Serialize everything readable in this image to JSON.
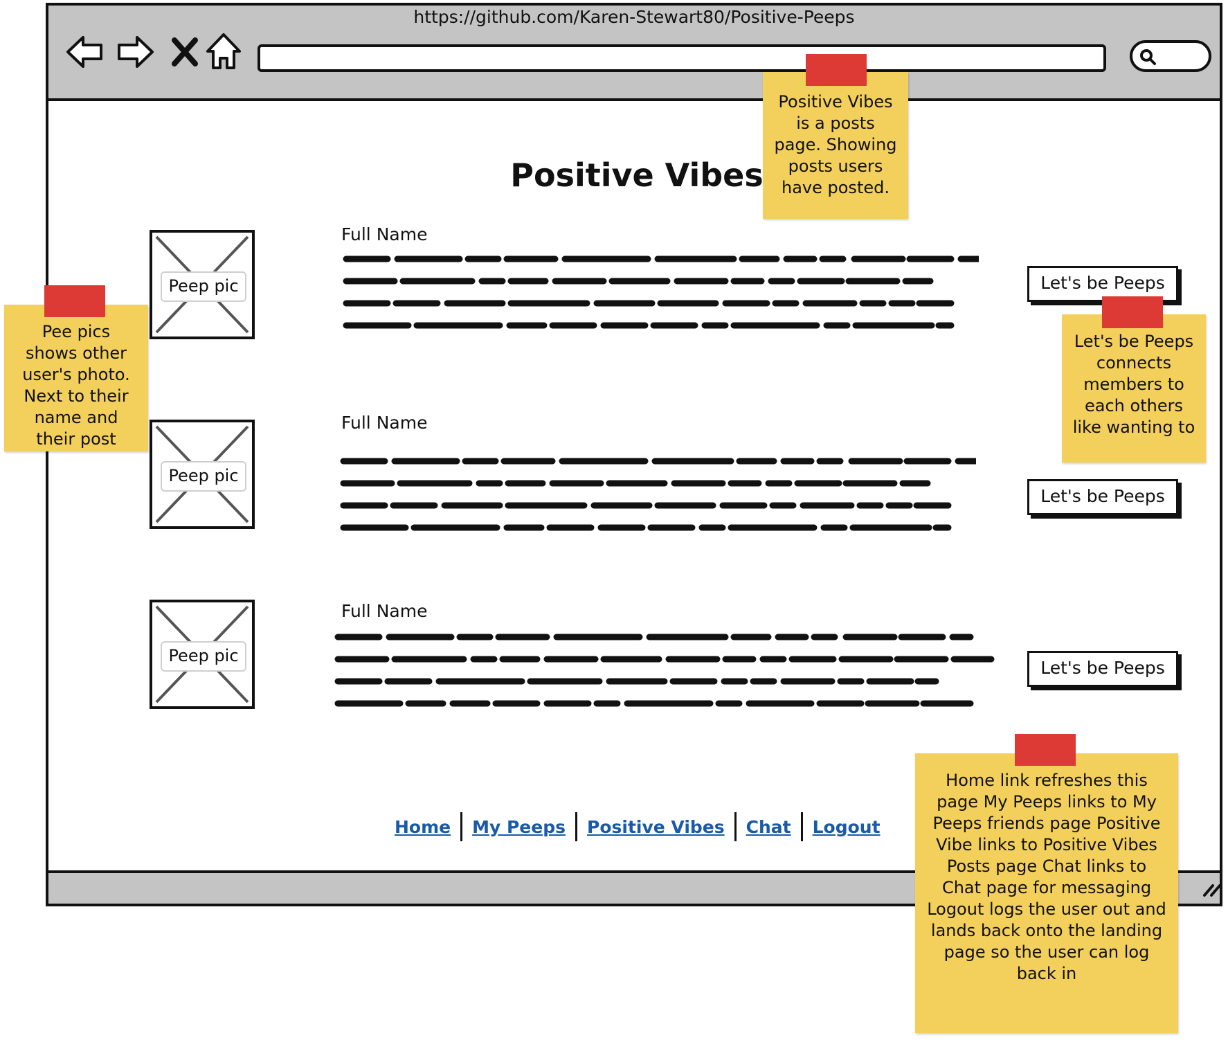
{
  "browser": {
    "url": "https://github.com/Karen-Stewart80/Positive-Peeps"
  },
  "page": {
    "title": "Positive Vibes"
  },
  "posts": [
    {
      "name": "Full Name",
      "pic_label": "Peep pic",
      "button_label": "Let's be Peeps"
    },
    {
      "name": "Full Name",
      "pic_label": "Peep pic",
      "button_label": "Let's be Peeps"
    },
    {
      "name": "Full Name",
      "pic_label": "Peep pic",
      "button_label": "Let's be Peeps"
    }
  ],
  "footer": {
    "links": [
      "Home",
      "My Peeps",
      "Positive Vibes",
      "Chat",
      "Logout"
    ]
  },
  "notes": {
    "title_note": "Positive Vibes is a posts page. Showing posts users have posted.",
    "pic_note": "Pee pics shows other user's photo. Next to their name and their post",
    "peeps_note": "Let's be Peeps connects members to each others like wanting to",
    "nav_note": "Home link refreshes this page My Peeps links to My Peeps friends page Positive Vibe links to Positive Vibes Posts page Chat links to Chat page for messaging Logout logs the user out and lands back onto the landing page so the user can log back in"
  },
  "colors": {
    "chrome": "#c4c4c4",
    "link": "#1a5aa6",
    "sticky_note": "#f3cf5c",
    "tape": "#dd3a35"
  }
}
